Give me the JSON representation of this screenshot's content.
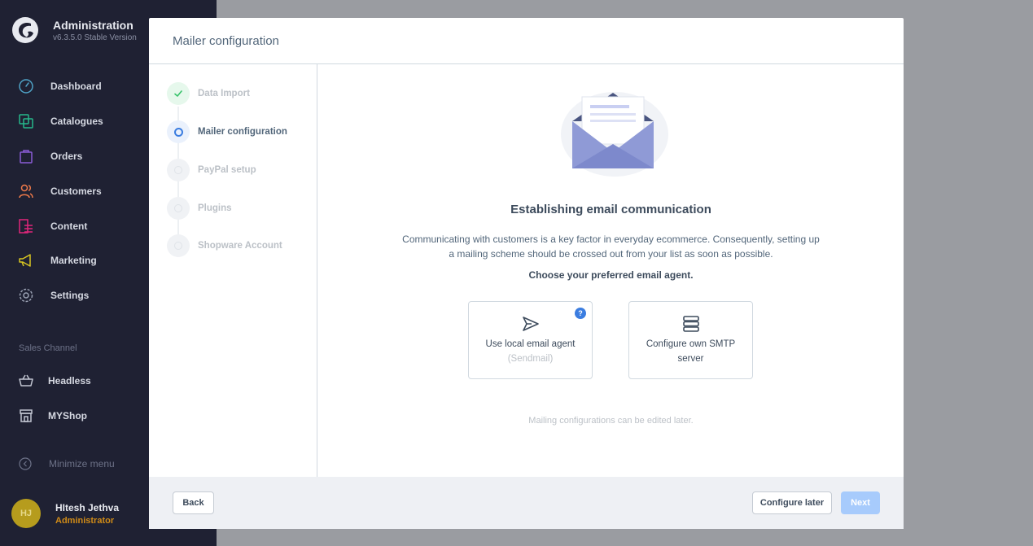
{
  "app": {
    "title": "Administration",
    "version": "v6.3.5.0 Stable Version"
  },
  "nav": {
    "items": [
      {
        "label": "Dashboard",
        "icon": "dashboard-icon",
        "color": "#4fa3c7"
      },
      {
        "label": "Catalogues",
        "icon": "catalogues-icon",
        "color": "#26b88b"
      },
      {
        "label": "Orders",
        "icon": "orders-icon",
        "color": "#8a5cd6"
      },
      {
        "label": "Customers",
        "icon": "customers-icon",
        "color": "#f07a4a"
      },
      {
        "label": "Content",
        "icon": "content-icon",
        "color": "#e0267b"
      },
      {
        "label": "Marketing",
        "icon": "marketing-icon",
        "color": "#d8c621"
      },
      {
        "label": "Settings",
        "icon": "settings-icon",
        "color": "#9aa1b3"
      }
    ],
    "sales_channel_title": "Sales Channel",
    "channels": [
      {
        "label": "Headless",
        "icon": "basket-icon"
      },
      {
        "label": "MYShop",
        "icon": "storefront-icon"
      }
    ],
    "minimize_label": "Minimize menu"
  },
  "user": {
    "initials": "HJ",
    "name": "HItesh Jethva",
    "role": "Administrator"
  },
  "modal": {
    "title": "Mailer configuration",
    "steps": [
      {
        "label": "Data Import",
        "state": "done"
      },
      {
        "label": "Mailer configuration",
        "state": "active"
      },
      {
        "label": "PayPal setup",
        "state": "pending"
      },
      {
        "label": "Plugins",
        "state": "pending"
      },
      {
        "label": "Shopware Account",
        "state": "pending"
      }
    ],
    "heading": "Establishing email communication",
    "description": "Communicating with customers is a key factor in everyday ecommerce. Consequently, setting up a mailing scheme should be crossed out from your list as soon as possible.",
    "subheading": "Choose your preferred email agent.",
    "options": [
      {
        "label": "Use local email agent",
        "sublabel": "(Sendmail)",
        "icon": "send-icon",
        "help": "?"
      },
      {
        "label": "Configure own SMTP server",
        "icon": "server-icon"
      }
    ],
    "note": "Mailing configurations can be edited later.",
    "buttons": {
      "back": "Back",
      "configure_later": "Configure later",
      "next": "Next"
    }
  }
}
